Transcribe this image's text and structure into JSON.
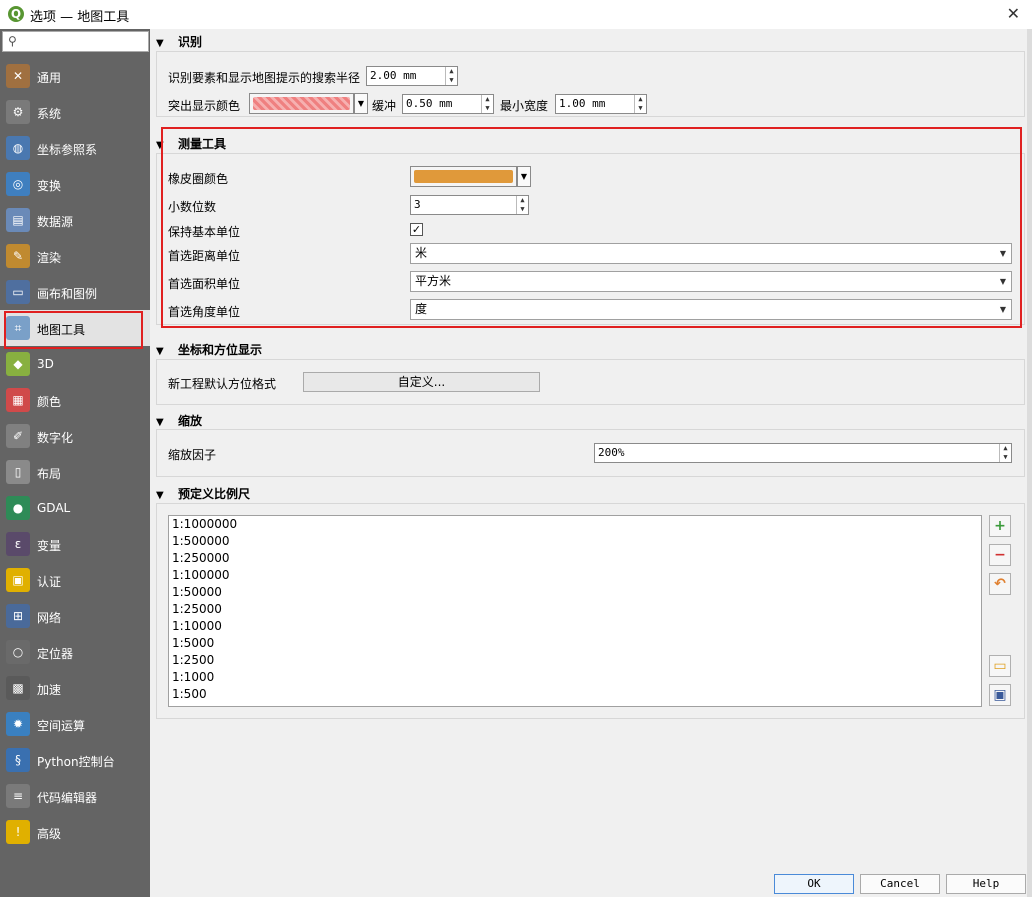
{
  "window": {
    "title": "选项 — 地图工具",
    "app_icon": "Q"
  },
  "search": {
    "placeholder": ""
  },
  "sidebar": {
    "items": [
      {
        "label": "通用",
        "icon": "wrench-screwdriver-icon",
        "color": "#a07040"
      },
      {
        "label": "系统",
        "icon": "gear-tools-icon",
        "color": "#7a7a7a"
      },
      {
        "label": "坐标参照系",
        "icon": "globe-grid-icon",
        "color": "#4a78b0"
      },
      {
        "label": "变换",
        "icon": "globe-transform-icon",
        "color": "#3f7fbf"
      },
      {
        "label": "数据源",
        "icon": "table-icon",
        "color": "#6a8ab8"
      },
      {
        "label": "渲染",
        "icon": "paintbrush-icon",
        "color": "#c08a30"
      },
      {
        "label": "画布和图例",
        "icon": "canvas-legend-icon",
        "color": "#4f6f9f"
      },
      {
        "label": "地图工具",
        "icon": "map-tools-icon",
        "color": "#7aa0c8"
      },
      {
        "label": "3D",
        "icon": "cube-3d-icon",
        "color": "#88b040"
      },
      {
        "label": "颜色",
        "icon": "color-palette-icon",
        "color": "#d04a4a"
      },
      {
        "label": "数字化",
        "icon": "digitize-icon",
        "color": "#808080"
      },
      {
        "label": "布局",
        "icon": "layout-icon",
        "color": "#8a8a8a"
      },
      {
        "label": "GDAL",
        "icon": "gdal-globe-icon",
        "color": "#2e8b57"
      },
      {
        "label": "变量",
        "icon": "variable-epsilon-icon",
        "color": "#5a4a6a"
      },
      {
        "label": "认证",
        "icon": "padlock-icon",
        "color": "#e0b000"
      },
      {
        "label": "网络",
        "icon": "network-icon",
        "color": "#4a6a9a"
      },
      {
        "label": "定位器",
        "icon": "magnifier-icon",
        "color": "#6a6a6a"
      },
      {
        "label": "加速",
        "icon": "chip-acceleration-icon",
        "color": "#5a5a5a"
      },
      {
        "label": "空间运算",
        "icon": "processing-gear-icon",
        "color": "#3a80c0"
      },
      {
        "label": "Python控制台",
        "icon": "python-icon",
        "color": "#3a70b0"
      },
      {
        "label": "代码编辑器",
        "icon": "code-editor-icon",
        "color": "#7a7a7a"
      },
      {
        "label": "高级",
        "icon": "warning-triangle-icon",
        "color": "#e0b000"
      }
    ]
  },
  "identify": {
    "title": "识别",
    "search_radius_label": "识别要素和显示地图提示的搜索半径",
    "search_radius_value": "2.00 mm",
    "highlight_color_label": "突出显示颜色",
    "highlight_color": "#ef8080",
    "buffer_label": "缓冲",
    "buffer_value": "0.50 mm",
    "min_width_label": "最小宽度",
    "min_width_value": "1.00 mm"
  },
  "measure": {
    "title": "测量工具",
    "rubber_band_color_label": "橡皮圈颜色",
    "rubber_band_color": "#e0993a",
    "decimal_places_label": "小数位数",
    "decimal_places_value": "3",
    "keep_base_unit_label": "保持基本单位",
    "keep_base_unit_checked": true,
    "check_mark": "✓",
    "distance_unit_label": "首选距离单位",
    "distance_unit_value": "米",
    "area_unit_label": "首选面积单位",
    "area_unit_value": "平方米",
    "angle_unit_label": "首选角度单位",
    "angle_unit_value": "度"
  },
  "coords": {
    "title": "坐标和方位显示",
    "bearing_format_label": "新工程默认方位格式",
    "custom_button": "自定义..."
  },
  "zoom": {
    "title": "缩放",
    "factor_label": "缩放因子",
    "factor_value": "200%"
  },
  "scales": {
    "title": "预定义比例尺",
    "list": [
      "1:1000000",
      "1:500000",
      "1:250000",
      "1:100000",
      "1:50000",
      "1:25000",
      "1:10000",
      "1:5000",
      "1:2500",
      "1:1000",
      "1:500"
    ]
  },
  "footer": {
    "ok": "OK",
    "cancel": "Cancel",
    "help": "Help"
  }
}
